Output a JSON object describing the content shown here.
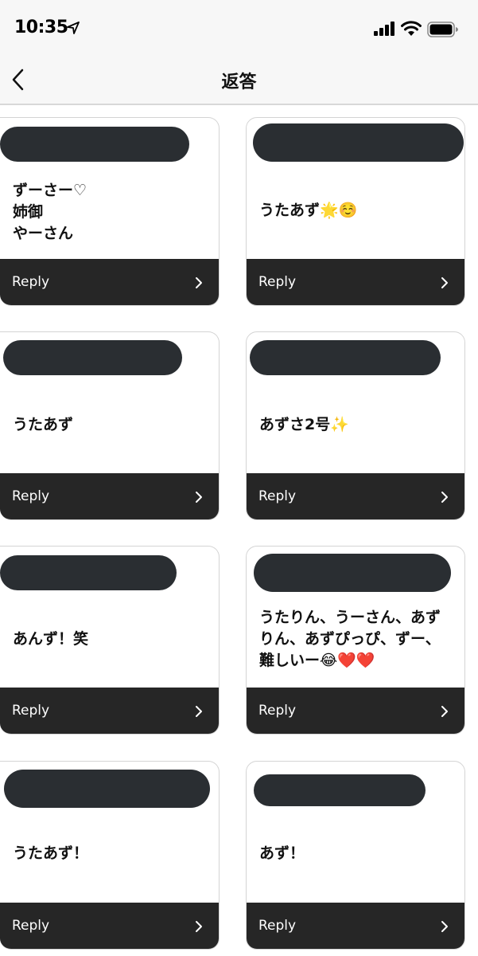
{
  "status_bar": {
    "time": "10:35",
    "icons": [
      "location-arrow-icon",
      "signal-icon",
      "wifi-icon",
      "battery-icon"
    ]
  },
  "nav": {
    "title": "返答",
    "back_icon": "chevron-left-icon"
  },
  "cards": [
    {
      "answer": "ずーさー♡\n姉御\nやーさん",
      "reply_label": "Reply"
    },
    {
      "answer": "うたあず🌟☺️",
      "reply_label": "Reply"
    },
    {
      "answer": "うたあず",
      "reply_label": "Reply"
    },
    {
      "answer": "あずさ2号✨",
      "reply_label": "Reply"
    },
    {
      "answer": "あんず！笑",
      "reply_label": "Reply"
    },
    {
      "answer": "うたりん、うーさん、あずりん、あずぴっぴ、ずー、難しいー😂❤️❤️",
      "reply_label": "Reply"
    },
    {
      "answer": "うたあず！",
      "reply_label": "Reply"
    },
    {
      "answer": "あず！",
      "reply_label": "Reply"
    }
  ],
  "colors": {
    "reply_bar": "#262626",
    "redaction": "#2a2e32",
    "nav_background": "#f7f7f7"
  }
}
